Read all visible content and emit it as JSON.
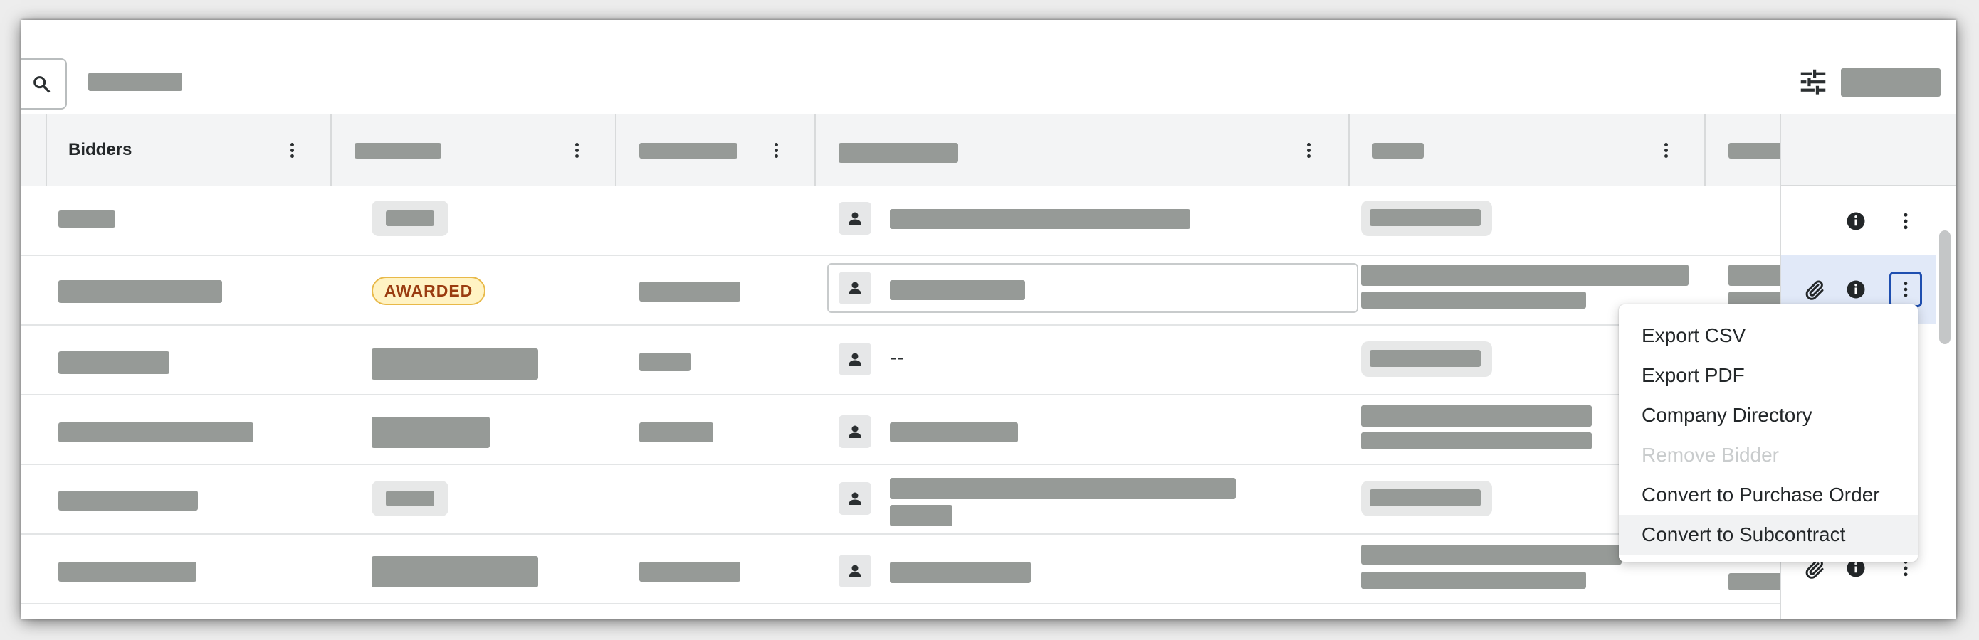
{
  "toolbar": {
    "search_icon": "search-icon",
    "filter_icon": "tune-sliders-icon"
  },
  "table": {
    "columns": [
      {
        "label": "Bidders"
      },
      {
        "label": ""
      },
      {
        "label": ""
      },
      {
        "label": ""
      },
      {
        "label": ""
      },
      {
        "label": ""
      }
    ],
    "rows": [
      {
        "status": ""
      },
      {
        "status": "AWARDED"
      },
      {
        "contact": "--"
      },
      {},
      {},
      {}
    ]
  },
  "row_actions": {
    "icons": [
      "paperclip-icon",
      "info-icon",
      "more-vertical-icon"
    ]
  },
  "context_menu": {
    "items": [
      {
        "label": "Export CSV",
        "disabled": false
      },
      {
        "label": "Export PDF",
        "disabled": false
      },
      {
        "label": "Company Directory",
        "disabled": false
      },
      {
        "label": "Remove Bidder",
        "disabled": true
      },
      {
        "label": "Convert to Purchase Order",
        "disabled": false
      },
      {
        "label": "Convert to Subcontract",
        "disabled": false,
        "hovered": true
      }
    ]
  },
  "colors": {
    "redaction_gray": "#969a97",
    "awarded_bg": "#fff3c4",
    "awarded_text": "#9a3c10",
    "selected_row": "#e1e9f8",
    "focus_ring": "#1f4fb0"
  }
}
